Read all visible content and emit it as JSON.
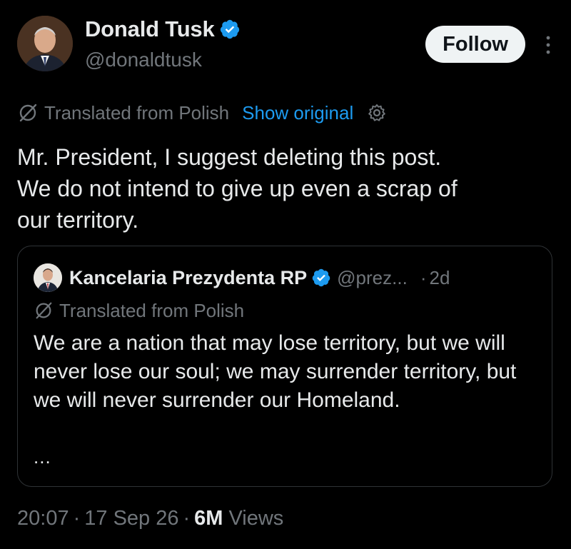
{
  "author": {
    "display_name": "Donald Tusk",
    "handle": "@donaldtusk",
    "verified": true,
    "avatar_icon": "profile-photo"
  },
  "actions": {
    "follow_label": "Follow",
    "more_icon": "vertical-ellipsis-icon"
  },
  "translation": {
    "label": "Translated from Polish",
    "show_original_label": "Show original",
    "settings_icon": "gear-icon"
  },
  "tweet": {
    "text": "Mr. President, I suggest deleting this post.\nWe do not intend to give up even a scrap of\nour territory."
  },
  "quoted_post": {
    "display_name": "Kancelaria Prezydenta RP",
    "handle": "@prez...",
    "dot": "·",
    "time": "2d",
    "verified": true,
    "translation_label": "Translated from Polish",
    "text": "We are a nation that may lose territory, but we will never lose our soul; we may surrender territory, but we will never surrender our Homeland.",
    "ellipsis": "..."
  },
  "meta": {
    "time": "20:07",
    "date": "17 Sep 26",
    "separator": "·",
    "views_count": "6M",
    "views_label": "Views"
  },
  "colors": {
    "background": "#000000",
    "text_primary": "#e7e9ea",
    "text_secondary": "#71767b",
    "accent_blue": "#1d9bf0",
    "border": "#2f3336",
    "follow_button_bg": "#eff3f4"
  }
}
